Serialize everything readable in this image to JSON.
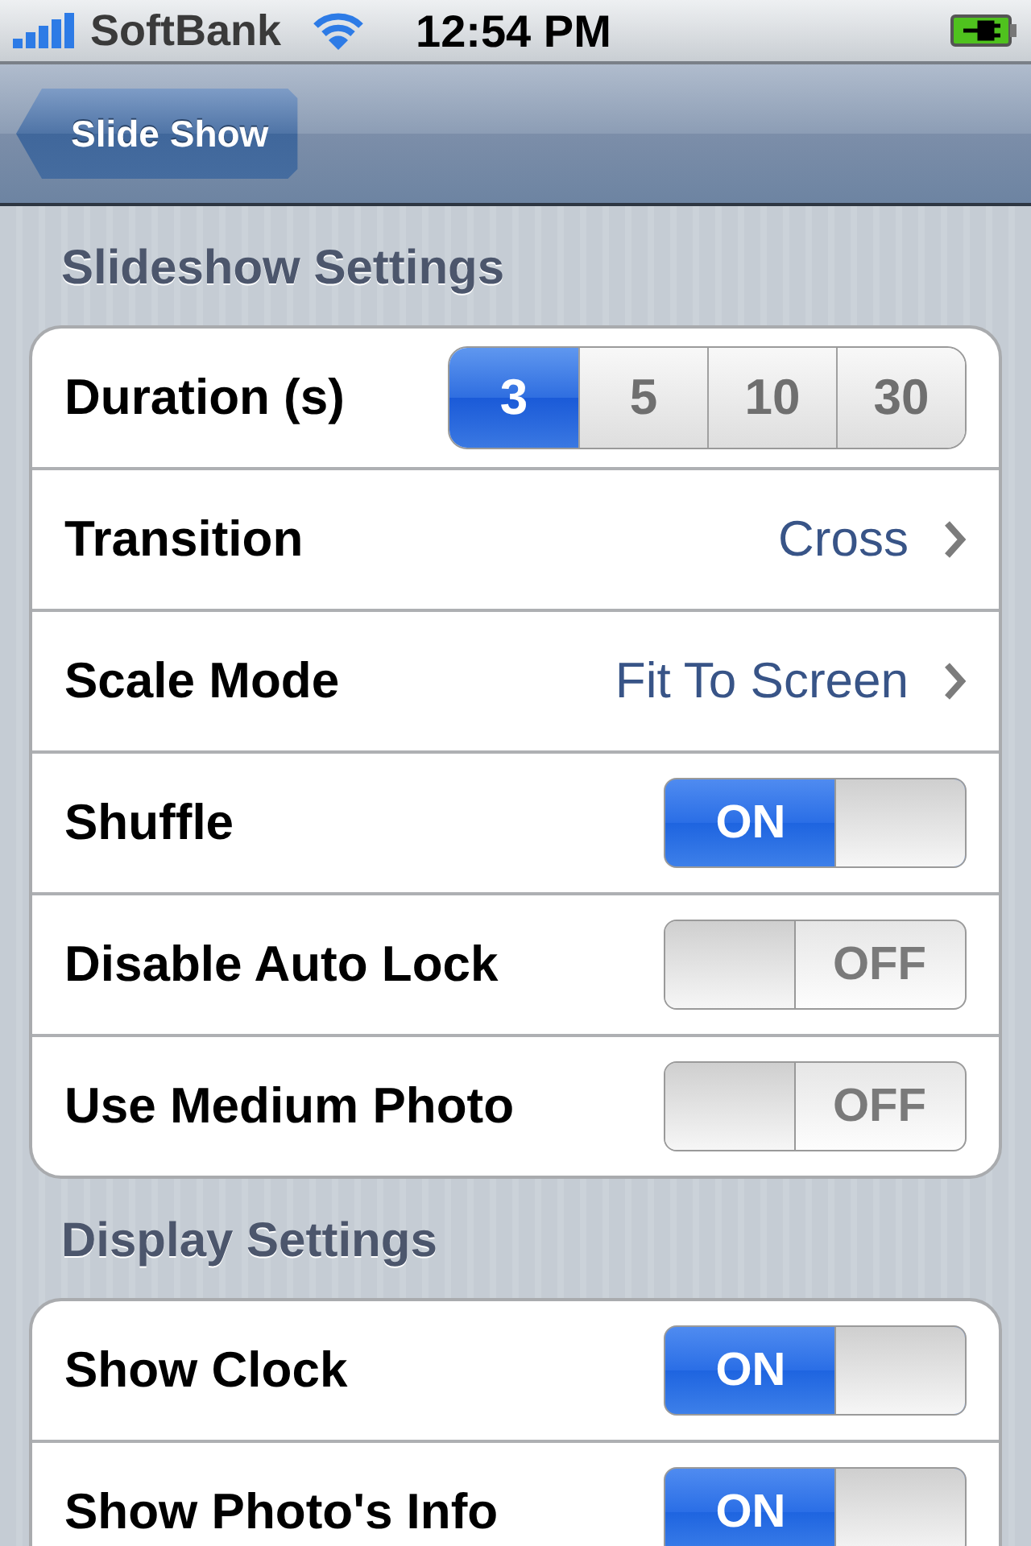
{
  "status_bar": {
    "carrier": "SoftBank",
    "time": "12:54 PM"
  },
  "nav_bar": {
    "back_button": "Slide Show"
  },
  "sections": [
    {
      "header": "Slideshow Settings",
      "rows": [
        {
          "kind": "segmented",
          "label": "Duration (s)",
          "options": [
            {
              "label": "3",
              "selected": true
            },
            {
              "label": "5",
              "selected": false
            },
            {
              "label": "10",
              "selected": false
            },
            {
              "label": "30",
              "selected": false
            }
          ]
        },
        {
          "kind": "disclosure",
          "label": "Transition",
          "value": "Cross"
        },
        {
          "kind": "disclosure",
          "label": "Scale Mode",
          "value": "Fit To Screen"
        },
        {
          "kind": "switch",
          "label": "Shuffle",
          "on": true,
          "text": "ON"
        },
        {
          "kind": "switch",
          "label": "Disable Auto Lock",
          "on": false,
          "text": "OFF"
        },
        {
          "kind": "switch",
          "label": "Use Medium Photo",
          "on": false,
          "text": "OFF"
        }
      ]
    },
    {
      "header": "Display Settings",
      "rows": [
        {
          "kind": "switch",
          "label": "Show Clock",
          "on": true,
          "text": "ON"
        },
        {
          "kind": "switch",
          "label": "Show Photo's Info",
          "on": true,
          "text": "ON"
        }
      ]
    }
  ]
}
